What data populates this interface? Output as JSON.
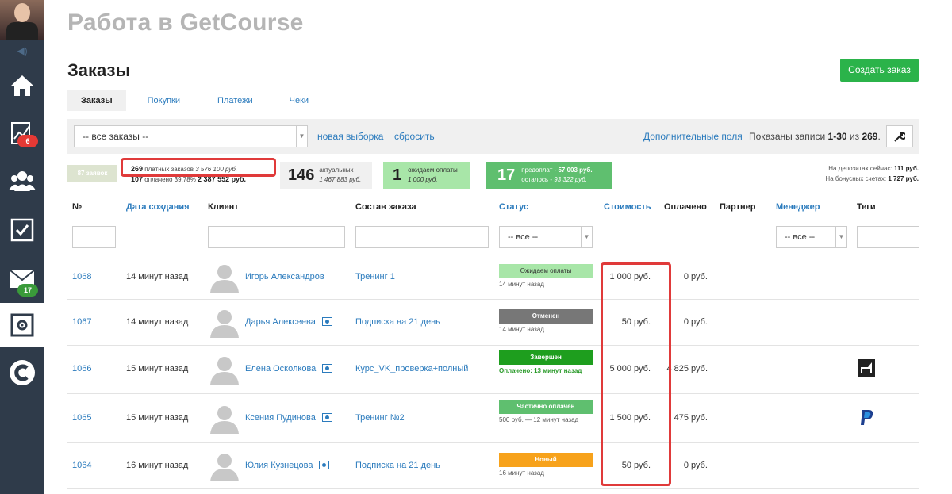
{
  "header": {
    "title": "Работа в GetCourse",
    "section": "Заказы",
    "create_button": "Создать заказ"
  },
  "tabs": [
    "Заказы",
    "Покупки",
    "Платежи",
    "Чеки"
  ],
  "filter": {
    "selected": "-- все заказы --",
    "new_selection": "новая выборка",
    "reset": "сбросить",
    "extra_fields": "Дополнительные поля",
    "shown_prefix": "Показаны записи ",
    "shown_range": "1-30",
    "shown_mid": " из ",
    "shown_total": "269",
    "shown_end": "."
  },
  "sidebar": {
    "tasks_badge": "6",
    "mail_badge": "17"
  },
  "stats": {
    "requests": "87 заявок",
    "paid_count": "269",
    "paid_label": " платных заказов  ",
    "paid_sum": "3 576 100 руб.",
    "paid_done_count": "107",
    "paid_done_label": " оплачено 39.78%  ",
    "paid_done_sum": "2 387 552 руб.",
    "actual_count": "146",
    "actual_label": "актуальных",
    "actual_sum": "1 467 883 руб.",
    "waiting_count": "1",
    "waiting_label": "ожидаем оплаты",
    "waiting_sum": "1 000 руб.",
    "prepay_count": "17",
    "prepay_label": "предоплат - ",
    "prepay_sum": "57 003 руб.",
    "prepay_left_label": "осталось - ",
    "prepay_left": "93 322 руб.",
    "deposit_label": "На депозитах сейчас: ",
    "deposit_value": "111 руб.",
    "bonus_label": "На бонусных счетах: ",
    "bonus_value": "1 727 руб."
  },
  "columns": [
    "№",
    "Дата создания",
    "Клиент",
    "Состав заказа",
    "Статус",
    "Стоимость",
    "Оплачено",
    "Партнер",
    "Менеджер",
    "Теги"
  ],
  "column_filters": {
    "status": "-- все --",
    "manager": "-- все --"
  },
  "rows": [
    {
      "id": "1068",
      "date": "14 минут назад",
      "client": "Игорь Александров",
      "order": "Тренинг 1",
      "status": "Ожидаем оплаты",
      "status_note": "14 минут назад",
      "cost": "1 000 руб.",
      "paid": "0 руб."
    },
    {
      "id": "1067",
      "date": "14 минут назад",
      "client": "Дарья Алексеева",
      "order": "Подписка на 21 день",
      "status": "Отменен",
      "status_note": "14 минут назад",
      "cost": "50 руб.",
      "paid": "0 руб."
    },
    {
      "id": "1066",
      "date": "15 минут назад",
      "client": "Елена Осколкова",
      "order": "Курс_VK_проверка+полный",
      "status": "Завершен",
      "status_note": "Оплачено: 13 минут назад",
      "cost": "5 000 руб.",
      "paid": "4 825 руб."
    },
    {
      "id": "1065",
      "date": "15 минут назад",
      "client": "Ксения Пудинова",
      "order": "Тренинг №2",
      "status": "Частично оплачен",
      "status_note": "500 руб. — 12 минут назад",
      "cost": "1 500 руб.",
      "paid": "475 руб."
    },
    {
      "id": "1064",
      "date": "16 минут назад",
      "client": "Юлия Кузнецова",
      "order": "Подписка на 21 день",
      "status": "Новый",
      "status_note": "16 минут назад",
      "cost": "50 руб.",
      "paid": "0 руб."
    }
  ],
  "colors": {
    "accent": "#2bb34a",
    "link": "#2b7bbd",
    "highlight": "#e03a3a",
    "status_wait": "#a8e6a8",
    "status_cancel": "#777777",
    "status_done": "#1e9e1e",
    "status_partial": "#5fbf6f",
    "status_new": "#f7a21b"
  }
}
